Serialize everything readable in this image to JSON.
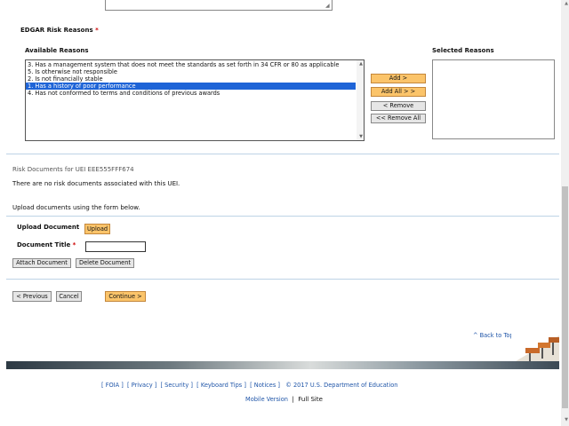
{
  "risk_reasons": {
    "label": "EDGAR Risk Reasons",
    "required_mark": "*",
    "available_label": "Available Reasons",
    "selected_label": "Selected Reasons",
    "available_options": [
      "3. Has a management system that does not meet the standards as set forth in 34 CFR or 80 as applicable",
      "5. Is otherwise not responsible",
      "2. Is not financially stable",
      "1. Has a history of poor performance",
      "4. Has not conformed to terms and conditions of previous awards"
    ],
    "selected_index": 3,
    "selected_options": [],
    "buttons": {
      "add": "Add >",
      "add_all": "Add All > >",
      "remove": "< Remove",
      "remove_all": "<< Remove All"
    }
  },
  "risk_documents": {
    "heading": "Risk Documents for UEI EEE555FFF674",
    "empty_message": "There are no risk documents associated with this UEI.",
    "instruction": "Upload documents using the form below.",
    "upload_label": "Upload Document",
    "upload_button": "Upload",
    "title_label": "Document Title",
    "title_required": "*",
    "title_value": "",
    "attach_button": "Attach Document",
    "delete_button": "Delete Document"
  },
  "nav_buttons": {
    "previous": "< Previous",
    "cancel": "Cancel",
    "continue": "Continue >"
  },
  "back_to_top": "^ Back to Top",
  "footer": {
    "links": [
      {
        "left": "[",
        "label": "FOIA",
        "right": "]"
      },
      {
        "left": "[",
        "label": "Privacy",
        "right": "]"
      },
      {
        "left": "[",
        "label": "Security",
        "right": "]"
      },
      {
        "left": "[",
        "label": "Keyboard Tips",
        "right": "]"
      },
      {
        "left": "[",
        "label": "Notices",
        "right": "]"
      }
    ],
    "copyright": "© 2017 U.S. Department of Education",
    "mobile": "Mobile Version",
    "separator": "|",
    "full_site": "Full Site"
  },
  "colors": {
    "accent_button": "#fbc46a",
    "selection": "#1e64d7",
    "link": "#1f55a8",
    "divider": "#bdd3e6"
  }
}
